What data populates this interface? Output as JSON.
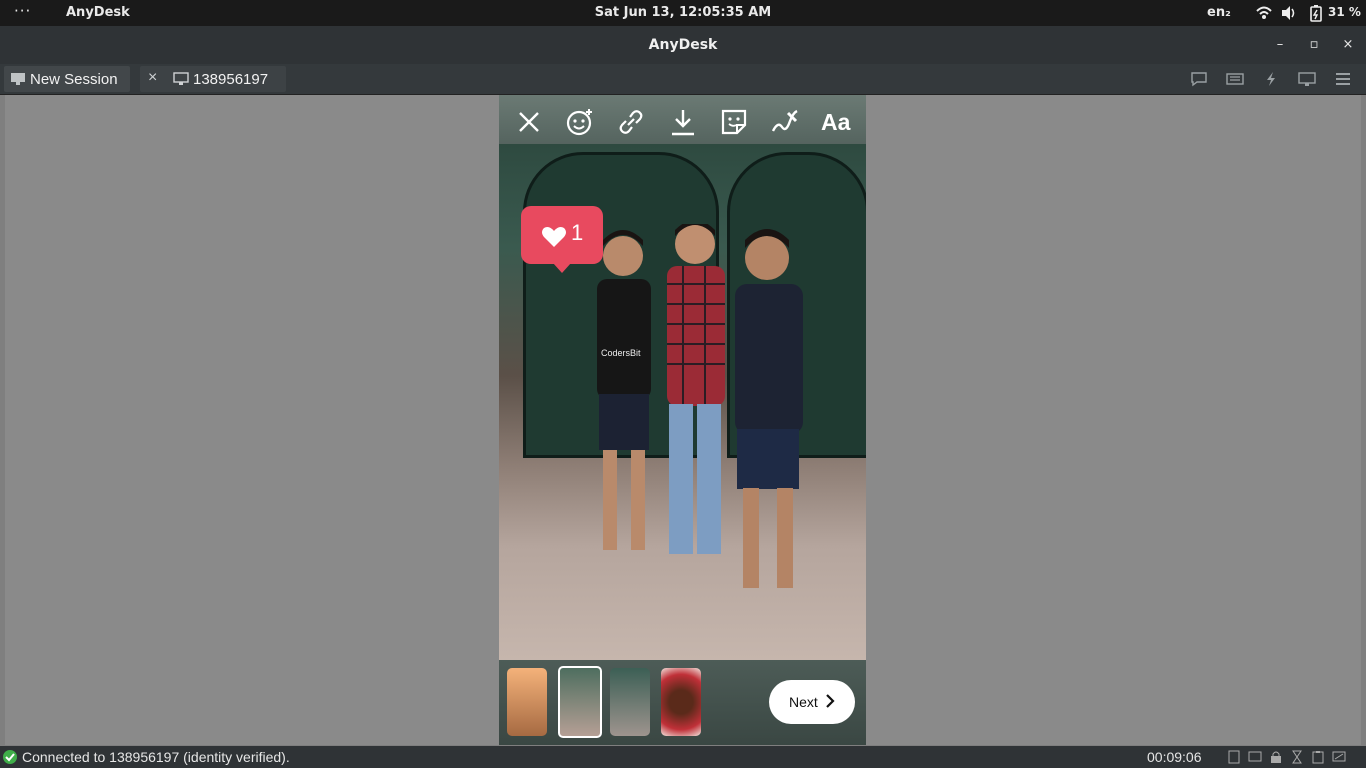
{
  "system_bar": {
    "activities": "···",
    "app_name": "AnyDesk",
    "clock": "Sat Jun 13, 12:05:35 AM",
    "language": "en₂",
    "battery": "31 %"
  },
  "window": {
    "title": "AnyDesk",
    "controls": [
      "minimize",
      "maximize",
      "close"
    ]
  },
  "tabs": [
    {
      "label": "New Session",
      "icon": "monitor-icon"
    },
    {
      "label": "138956197",
      "icon": "display-icon",
      "close": "×"
    }
  ],
  "toolbar_icons": [
    "chat-icon",
    "keyboard-icon",
    "actions-icon",
    "display-icon",
    "menu-icon"
  ],
  "story_editor": {
    "tools": [
      "close-icon",
      "face-filter-icon",
      "link-icon",
      "download-icon",
      "sticker-icon",
      "draw-icon",
      "text-tool"
    ],
    "text_tool_label": "Aa",
    "like_sticker": {
      "count": "1",
      "icon": "heart-icon"
    },
    "next_label": "Next",
    "thumbnails": 4,
    "selected_thumbnail": 2,
    "accent": "#e84a5f"
  },
  "status_bar": {
    "message": "Connected to 138956197 (identity verified).",
    "timer": "00:09:06",
    "status_icons": [
      "file-transfer-icon",
      "screen-icon",
      "lock-icon",
      "hourglass-icon",
      "clipboard-icon",
      "session-icon"
    ]
  }
}
